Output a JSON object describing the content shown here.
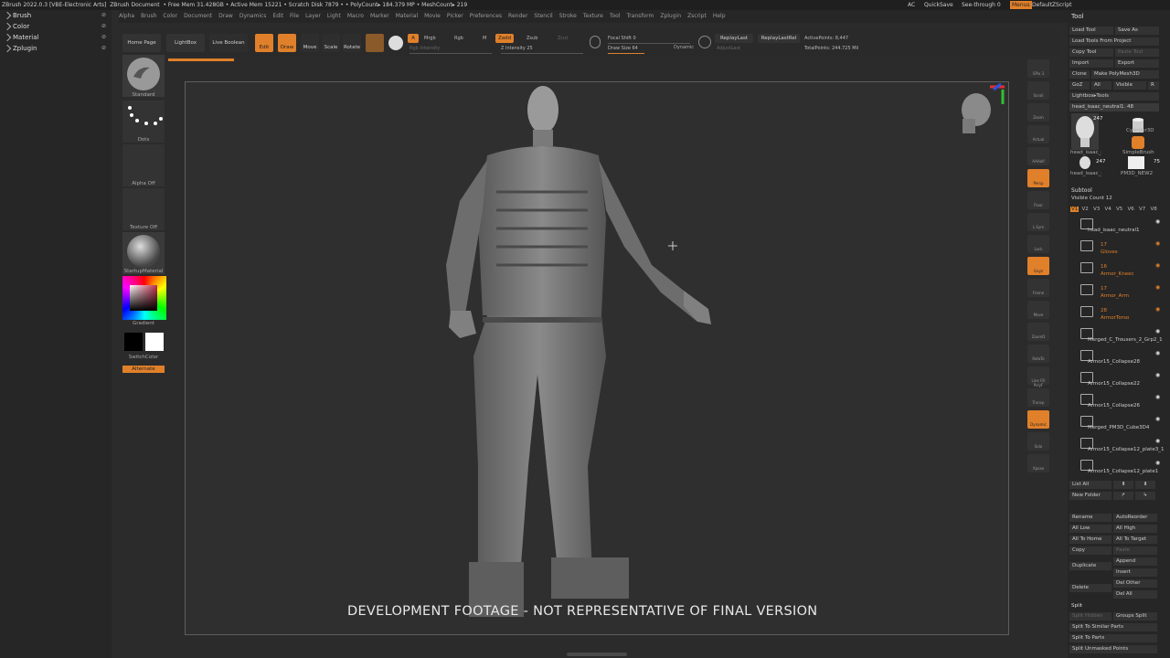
{
  "titlebar": {
    "title": "ZBrush 2022.0.3 [VBE-Electronic Arts]",
    "document": "ZBrush Document",
    "stats": "• Free Mem 31.428GB • Active Mem 15221 • Scratch Disk 7879 • • PolyCount▸ 184.379 MP • MeshCount▸ 219",
    "ac": "AC",
    "quicksave": "QuickSave",
    "see_through": "See-through  0",
    "menus_label": "Menus",
    "script": "DefaultZScript"
  },
  "menubar": [
    "Alpha",
    "Brush",
    "Color",
    "Document",
    "Draw",
    "Dynamics",
    "Edit",
    "File",
    "Layer",
    "Light",
    "Macro",
    "Marker",
    "Material",
    "Movie",
    "Picker",
    "Preferences",
    "Render",
    "Stencil",
    "Stroke",
    "Texture",
    "Tool",
    "Transform",
    "Zplugin",
    "Zscript",
    "Help"
  ],
  "left_panel": [
    {
      "label": "Brush"
    },
    {
      "label": "Color"
    },
    {
      "label": "Material"
    },
    {
      "label": "Zplugin"
    }
  ],
  "toolbar": {
    "home_page": "Home Page",
    "lightbox": "LightBox",
    "live_boolean": "Live Boolean",
    "edit": "Edit",
    "draw": "Draw",
    "move": "Move",
    "scale": "Scale",
    "rotate": "Rotate",
    "a": "A",
    "mrgb": "Mrgb",
    "rgb": "Rgb",
    "m": "M",
    "zadd": "Zadd",
    "zsub": "Zsub",
    "zcut": "Zcut",
    "rgb_intensity": "Rgb Intensity",
    "z_intensity": "Z Intensity 25",
    "focal_shift": "Focal Shift 0",
    "draw_size": "Draw Size 64",
    "dynamic": "Dynamic",
    "replay_last": "ReplayLast",
    "replay_last_rel": "ReplayLastRel",
    "active_points": "ActivePoints: 8,447",
    "total_points": "TotalPoints: 244.725 Mil",
    "adjust_last": "AdjustLast"
  },
  "left_shelf": {
    "brush": "Standard",
    "stroke": "Dots",
    "alpha": "Alpha Off",
    "texture": "Texture Off",
    "material": "StartupMaterial",
    "gradient": "Gradient",
    "switch_color": "SwitchColor",
    "alternate": "Alternate"
  },
  "viewport": {
    "watermark": "DEVELOPMENT FOOTAGE - NOT REPRESENTATIVE OF FINAL VERSION"
  },
  "right_shelf": [
    {
      "label": "SPix 3"
    },
    {
      "label": "Scroll"
    },
    {
      "label": "Zoom"
    },
    {
      "label": "Actual"
    },
    {
      "label": "AAHalf"
    },
    {
      "label": "Persp"
    },
    {
      "label": "Floor"
    },
    {
      "label": "L.Sym"
    },
    {
      "label": "Lock"
    },
    {
      "label": "Gxyz"
    },
    {
      "label": "Frame"
    },
    {
      "label": "Move"
    },
    {
      "label": "ZoomD"
    },
    {
      "label": "RotaTe"
    },
    {
      "label": "Line Fill PolyF"
    },
    {
      "label": "Transp"
    },
    {
      "label": "Dynamic"
    },
    {
      "label": "Solo"
    },
    {
      "label": "Xpose"
    }
  ],
  "tool_panel": {
    "title": "Tool",
    "load_tool": "Load Tool",
    "save_as": "Save As",
    "load_from_project": "Load Tools From Project",
    "copy_tool": "Copy Tool",
    "paste_tool": "Paste Tool",
    "import": "Import",
    "export": "Export",
    "clone": "Clone",
    "make_polymesh": "Make PolyMesh3D",
    "goz": "GoZ",
    "all": "All",
    "visible": "Visible",
    "r": "R",
    "lightbox_tools": "Lightbox▸Tools",
    "current_tool": "head_isaac_neutral1. 48",
    "thumbs": [
      {
        "name": "head_isaac_neut",
        "count": "247"
      },
      {
        "name": "Cylinder3D",
        "count": ""
      },
      {
        "name": "SimpleBrush",
        "count": ""
      },
      {
        "name": "head_isaac_neut",
        "count": "247"
      },
      {
        "name": "PM3D_NEW2",
        "count": "75"
      }
    ],
    "subtool_header": "Subtool",
    "visible_count": "Visible Count 12",
    "tabs": [
      "V1",
      "V2",
      "V3",
      "V4",
      "V5",
      "V6",
      "V7",
      "V8"
    ],
    "subtools": [
      {
        "name": "head_isaac_neutral1",
        "orange": false
      },
      {
        "name": "17\nGloves",
        "orange": true
      },
      {
        "name": "16\nArmor_Kneec",
        "orange": true
      },
      {
        "name": "17\nArmor_Arm",
        "orange": true
      },
      {
        "name": "28\nArmorTorso",
        "orange": true
      },
      {
        "name": "Merged_C_Trousers_2_Grp2_1",
        "orange": false
      },
      {
        "name": "Armor15_Collapse28",
        "orange": false
      },
      {
        "name": "Armor15_Collapse22",
        "orange": false
      },
      {
        "name": "Armor15_Collapse26",
        "orange": false
      },
      {
        "name": "Merged_PM3D_Cube3D4",
        "orange": false
      },
      {
        "name": "Armor15_Collapse12_plate3_1",
        "orange": false
      },
      {
        "name": "Armor15_Collapse12_plate1",
        "orange": false
      }
    ],
    "list_all": "List All",
    "new_folder": "New Folder",
    "rename": "Rename",
    "auto_reorder": "AutoReorder",
    "all_low": "All Low",
    "all_high": "All High",
    "all_to_home": "All To Home",
    "all_to_target": "All To Target",
    "copy": "Copy",
    "paste": "Paste",
    "duplicate": "Duplicate",
    "append": "Append",
    "insert": "Insert",
    "delete": "Delete",
    "del_other": "Del Other",
    "del_all": "Del All",
    "split": "Split",
    "split_hidden": "Split Hidden",
    "groups_split": "Groups Split",
    "split_to_similar": "Split To Similar Parts",
    "split_to_parts": "Split To Parts",
    "split_unmasked": "Split Unmasked Points"
  }
}
